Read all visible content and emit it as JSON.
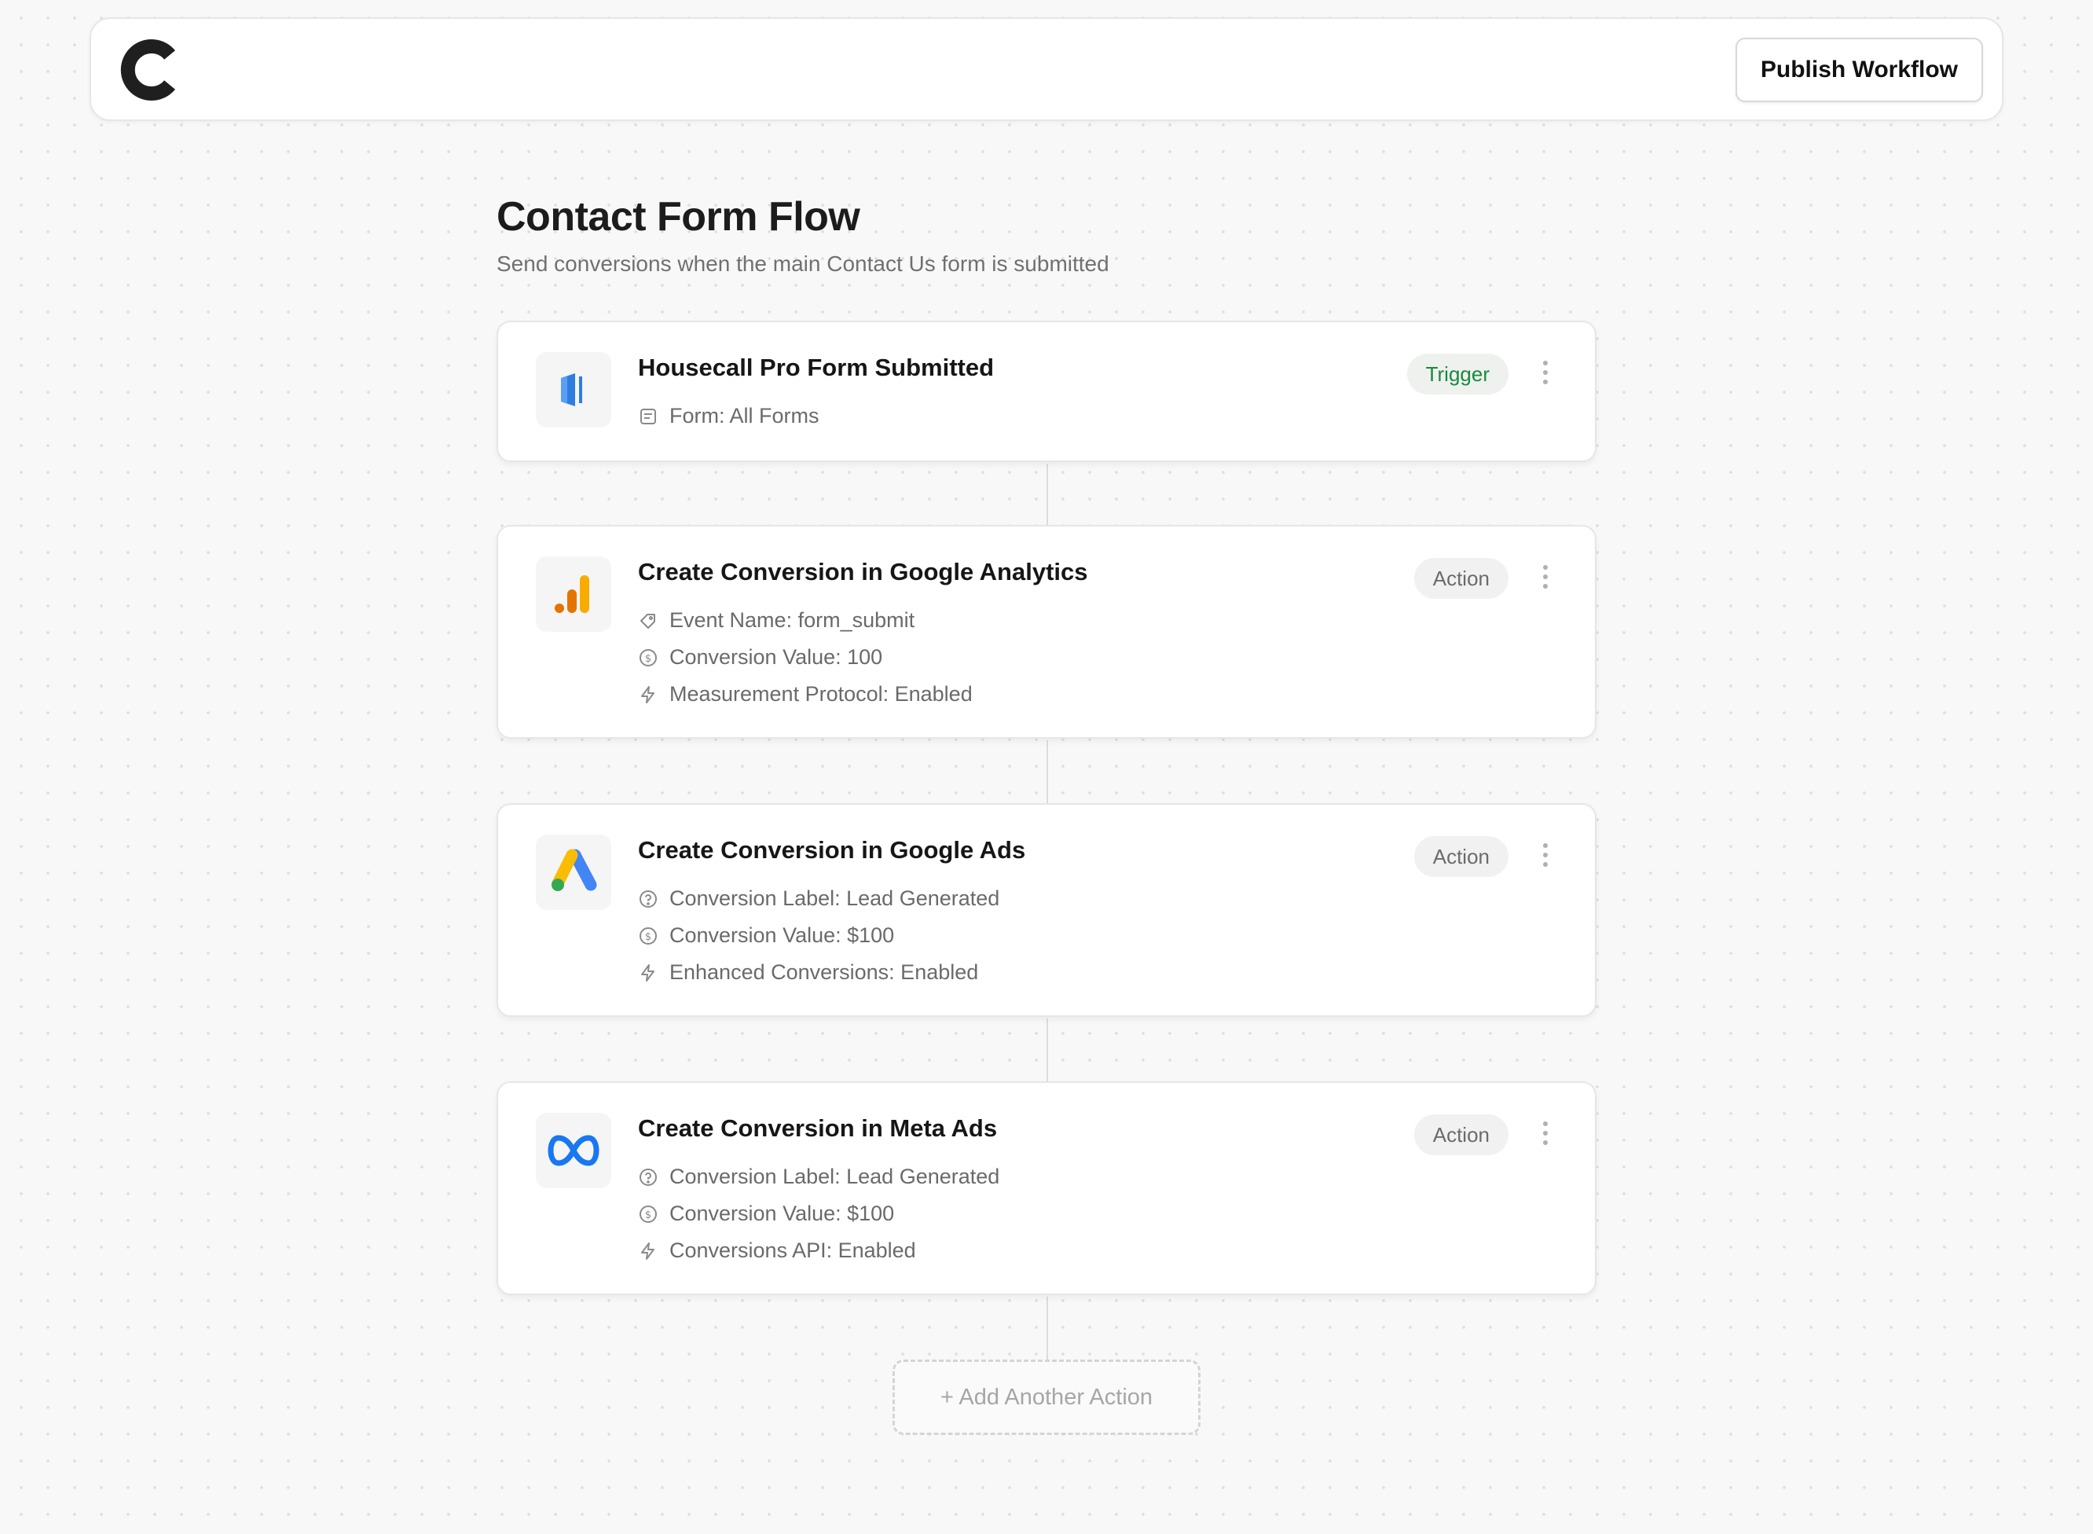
{
  "topbar": {
    "logo": "C",
    "publish_label": "Publish Workflow"
  },
  "workflow": {
    "title": "Contact Form Flow",
    "subtitle": "Send conversions when the main Contact Us form is submitted"
  },
  "steps": [
    {
      "icon": "housecall-pro-icon",
      "title": "Housecall Pro Form Submitted",
      "badge": "Trigger",
      "props": [
        {
          "icon": "form-icon",
          "text": "Form: All Forms"
        }
      ]
    },
    {
      "icon": "google-analytics-icon",
      "title": "Create Conversion in Google Analytics",
      "badge": "Action",
      "props": [
        {
          "icon": "tag-icon",
          "text": "Event Name: form_submit"
        },
        {
          "icon": "dollar-circle-icon",
          "text": "Conversion Value: 100"
        },
        {
          "icon": "lightning-icon",
          "text": "Measurement Protocol: Enabled"
        }
      ]
    },
    {
      "icon": "google-ads-icon",
      "title": "Create Conversion in Google Ads",
      "badge": "Action",
      "props": [
        {
          "icon": "help-circle-icon",
          "text": "Conversion Label: Lead Generated"
        },
        {
          "icon": "dollar-circle-icon",
          "text": "Conversion Value: $100"
        },
        {
          "icon": "lightning-icon",
          "text": "Enhanced Conversions: Enabled"
        }
      ]
    },
    {
      "icon": "meta-icon",
      "title": "Create Conversion in Meta Ads",
      "badge": "Action",
      "props": [
        {
          "icon": "help-circle-icon",
          "text": "Conversion Label: Lead Generated"
        },
        {
          "icon": "dollar-circle-icon",
          "text": "Conversion Value: $100"
        },
        {
          "icon": "lightning-icon",
          "text": "Conversions API: Enabled"
        }
      ]
    }
  ],
  "add_action_label": "+ Add Another Action",
  "colors": {
    "trigger": "#1a8a3c",
    "accent_blue": "#1877f2",
    "ga_orange": "#f9ab00",
    "ads_blue": "#4285f4",
    "ads_yellow": "#fbbc04",
    "ads_green": "#34a853"
  }
}
